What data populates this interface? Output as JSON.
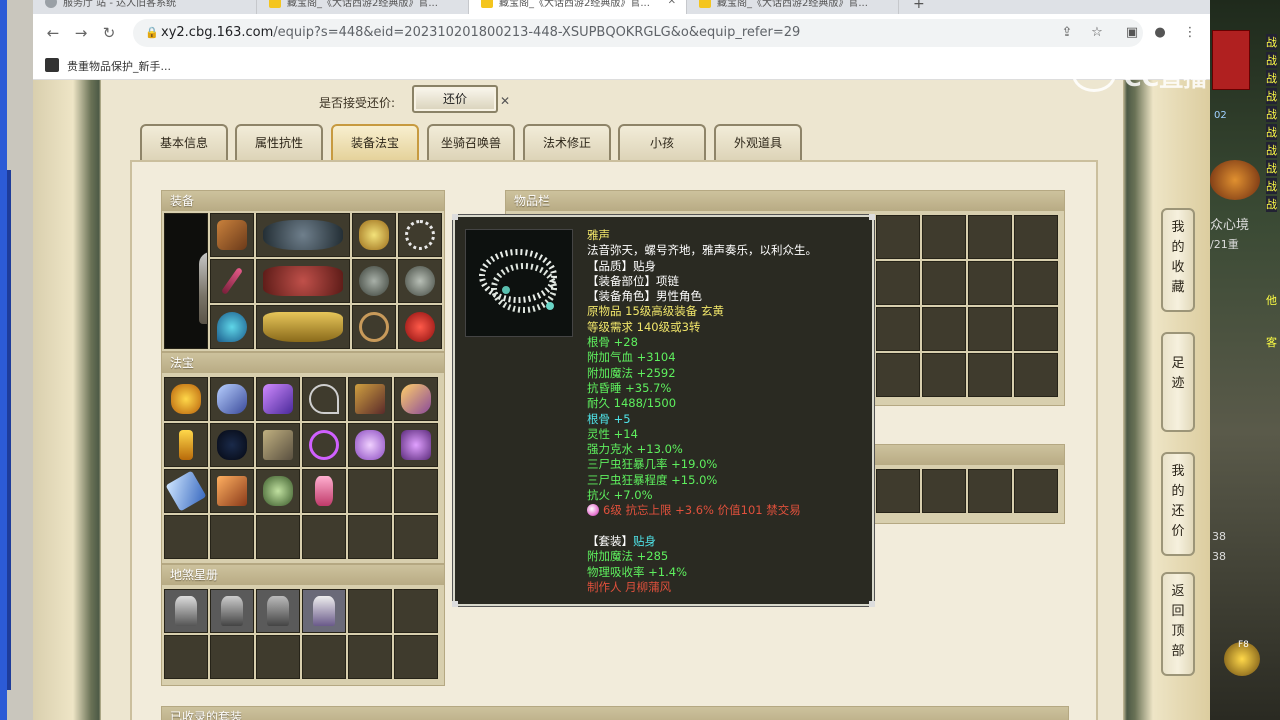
{
  "browser": {
    "tabs": [
      {
        "label": "服务厅 站 - 达人旧客系统",
        "active": false
      },
      {
        "label": "藏宝阁_《大话西游2经典版》官...",
        "active": false
      },
      {
        "label": "藏宝阁_《大话西游2经典版》官...",
        "active": true
      },
      {
        "label": "藏宝阁_《大话西游2经典版》官...",
        "active": false
      }
    ],
    "url_domain": "xy2.cbg.163.com",
    "url_rest": "/equip?s=448&eid=202310201800213-448-XSUPBQOKRGLG&o&equip_refer=29",
    "bookmark_label": "贵重物品保护_新手...",
    "new_tab": "+"
  },
  "page": {
    "bargain_label": "是否接受还价:",
    "bargain_button": "还价",
    "tabs": [
      "基本信息",
      "属性抗性",
      "装备法宝",
      "坐骑召唤兽",
      "法术修正",
      "小孩",
      "外观道具"
    ],
    "active_tab": 2,
    "sections": {
      "equipment": "装备",
      "treasure": "法宝",
      "constellation": "地煞星册",
      "inventory": "物品栏",
      "collected": "已收录的套装"
    },
    "side_buttons": [
      "我的收藏",
      "足迹",
      "我的还价",
      "返回顶部"
    ]
  },
  "tooltip": {
    "name": "雅声",
    "desc": "法音弥天，螺号齐地，雅声奏乐，以利众生。",
    "quality": "【品质】贴身",
    "slot": "【装备部位】项链",
    "role": "【装备角色】男性角色",
    "origin": "原物品 15级高级装备 玄黄",
    "level_req": "等级需求 140级或3转",
    "stats_green": [
      "根骨 +28",
      "附加气血 +3104",
      "附加魔法 +2592",
      "抗昏睡 +35.7%",
      "耐久 1488/1500"
    ],
    "stats_cyan": [
      "根骨 +5",
      "灵性 +14"
    ],
    "stats_green2": [
      "强力克水 +13.0%",
      "三尸虫狂暴几率 +19.0%",
      "三尸虫狂暴程度 +15.0%",
      "抗火 +7.0%"
    ],
    "gem_line": "6级 抗忘上限 +3.6% 价值101 禁交易",
    "set_prefix": "【套装】",
    "set_name": "贴身",
    "set_stats": [
      "附加魔法 +285",
      "物理吸收率 +1.4%"
    ],
    "maker": "制作人 月柳蒲风"
  },
  "colors": {
    "tooltip_bg": "#2a2a22",
    "name": "#f0e56a",
    "green": "#5ef05e",
    "cyan": "#4fe3e8",
    "red": "#e0503c"
  },
  "game_overlay": {
    "labels": [
      "战",
      "战",
      "战",
      "战",
      "战",
      "战",
      "战",
      "战",
      "战",
      "战",
      "他",
      "客"
    ],
    "numbers": [
      "38",
      "38"
    ],
    "hotkey": "F8",
    "realm_text": "众心境",
    "floor_text": "/21重",
    "small_num": "02"
  },
  "watermark": "CC直播"
}
